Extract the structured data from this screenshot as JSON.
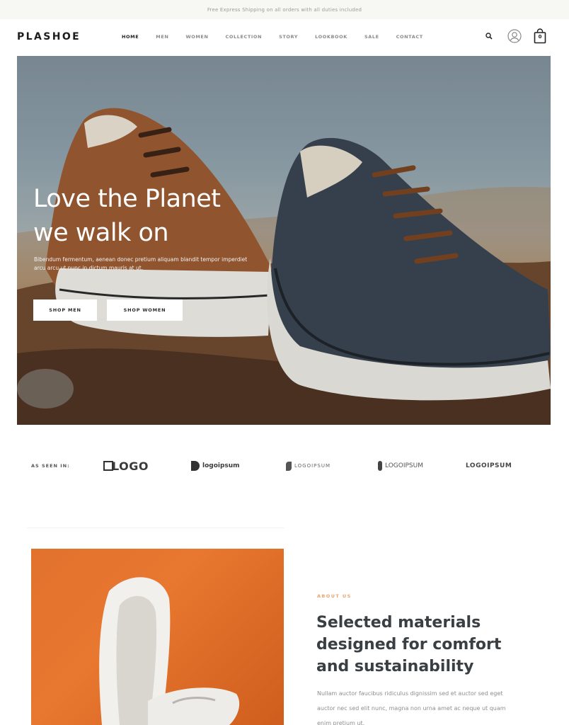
{
  "announcement": "Free Express Shipping on all orders with all duties included",
  "brand": "PLASHOE",
  "nav": {
    "items": [
      "HOME",
      "MEN",
      "WOMEN",
      "COLLECTION",
      "STORY",
      "LOOKBOOK",
      "SALE",
      "CONTACT"
    ],
    "active": "HOME"
  },
  "header_icons": {
    "search": "search-icon",
    "account": "user-icon",
    "cart": "bag-icon",
    "cart_count": "0"
  },
  "hero": {
    "title_line1": "Love the Planet",
    "title_line2": "we walk on",
    "text": "Bibendum fermentum, aenean donec pretium aliquam blandit tempor imperdiet arcu arcu ut nunc in dictum mauris at ut.",
    "button_men": "SHOP MEN",
    "button_women": "SHOP WOMEN"
  },
  "seen_in": {
    "label": "AS SEEN IN:",
    "logos": [
      "LOGO",
      "logoipsum",
      "LOGOIPSUM",
      "LOGOIPSUM",
      "LOGOIPSUM"
    ]
  },
  "about": {
    "label": "ABOUT US",
    "title": "Selected materials designed for comfort and sustainability",
    "text": "Nullam auctor faucibus ridiculus dignissim sed et auctor sed eget auctor nec sed elit nunc, magna non urna amet ac neque ut quam enim pretium ut."
  },
  "colors": {
    "accent": "#e9a56e",
    "hero_overlay": "#ffffff",
    "feature_bg": "#e1722e",
    "announce_bg": "#f7f8f3"
  }
}
